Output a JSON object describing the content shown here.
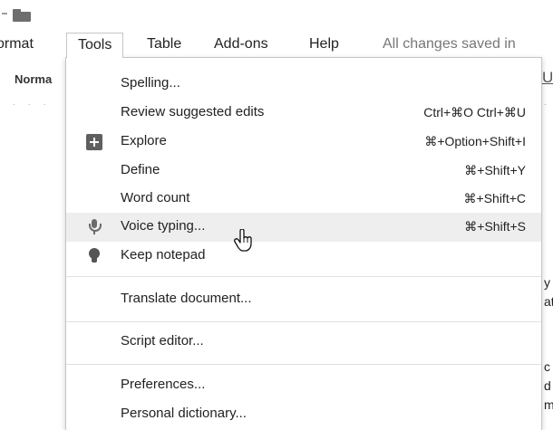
{
  "menubar": {
    "items": [
      "ormat",
      "Tools",
      "Table",
      "Add-ons",
      "Help"
    ],
    "active": "Tools",
    "status": "All changes saved in"
  },
  "toolbar": {
    "style_value": "Norma",
    "underline_label": "U"
  },
  "doc_fragments": [
    "y",
    "at",
    "c",
    "d a",
    "m"
  ],
  "tools_menu": {
    "groups": [
      [
        {
          "label": "Spelling...",
          "shortcut": "",
          "icon": ""
        },
        {
          "label": "Review suggested edits",
          "shortcut": "Ctrl+⌘O Ctrl+⌘U",
          "icon": ""
        },
        {
          "label": "Explore",
          "shortcut": "⌘+Option+Shift+I",
          "icon": "explore-icon"
        },
        {
          "label": "Define",
          "shortcut": "⌘+Shift+Y",
          "icon": ""
        },
        {
          "label": "Word count",
          "shortcut": "⌘+Shift+C",
          "icon": ""
        },
        {
          "label": "Voice typing...",
          "shortcut": "⌘+Shift+S",
          "icon": "microphone-icon",
          "hover": true
        },
        {
          "label": "Keep notepad",
          "shortcut": "",
          "icon": "lightbulb-icon"
        }
      ],
      [
        {
          "label": "Translate document...",
          "shortcut": "",
          "icon": ""
        }
      ],
      [
        {
          "label": "Script editor...",
          "shortcut": "",
          "icon": ""
        }
      ],
      [
        {
          "label": "Preferences...",
          "shortcut": "",
          "icon": ""
        },
        {
          "label": "Personal dictionary...",
          "shortcut": "",
          "icon": ""
        }
      ]
    ]
  },
  "colors": {
    "menu_border": "#c6c6c6",
    "hover_bg": "#eeeeee",
    "icon_gray": "#5f5f5f",
    "status_text": "#777777"
  }
}
